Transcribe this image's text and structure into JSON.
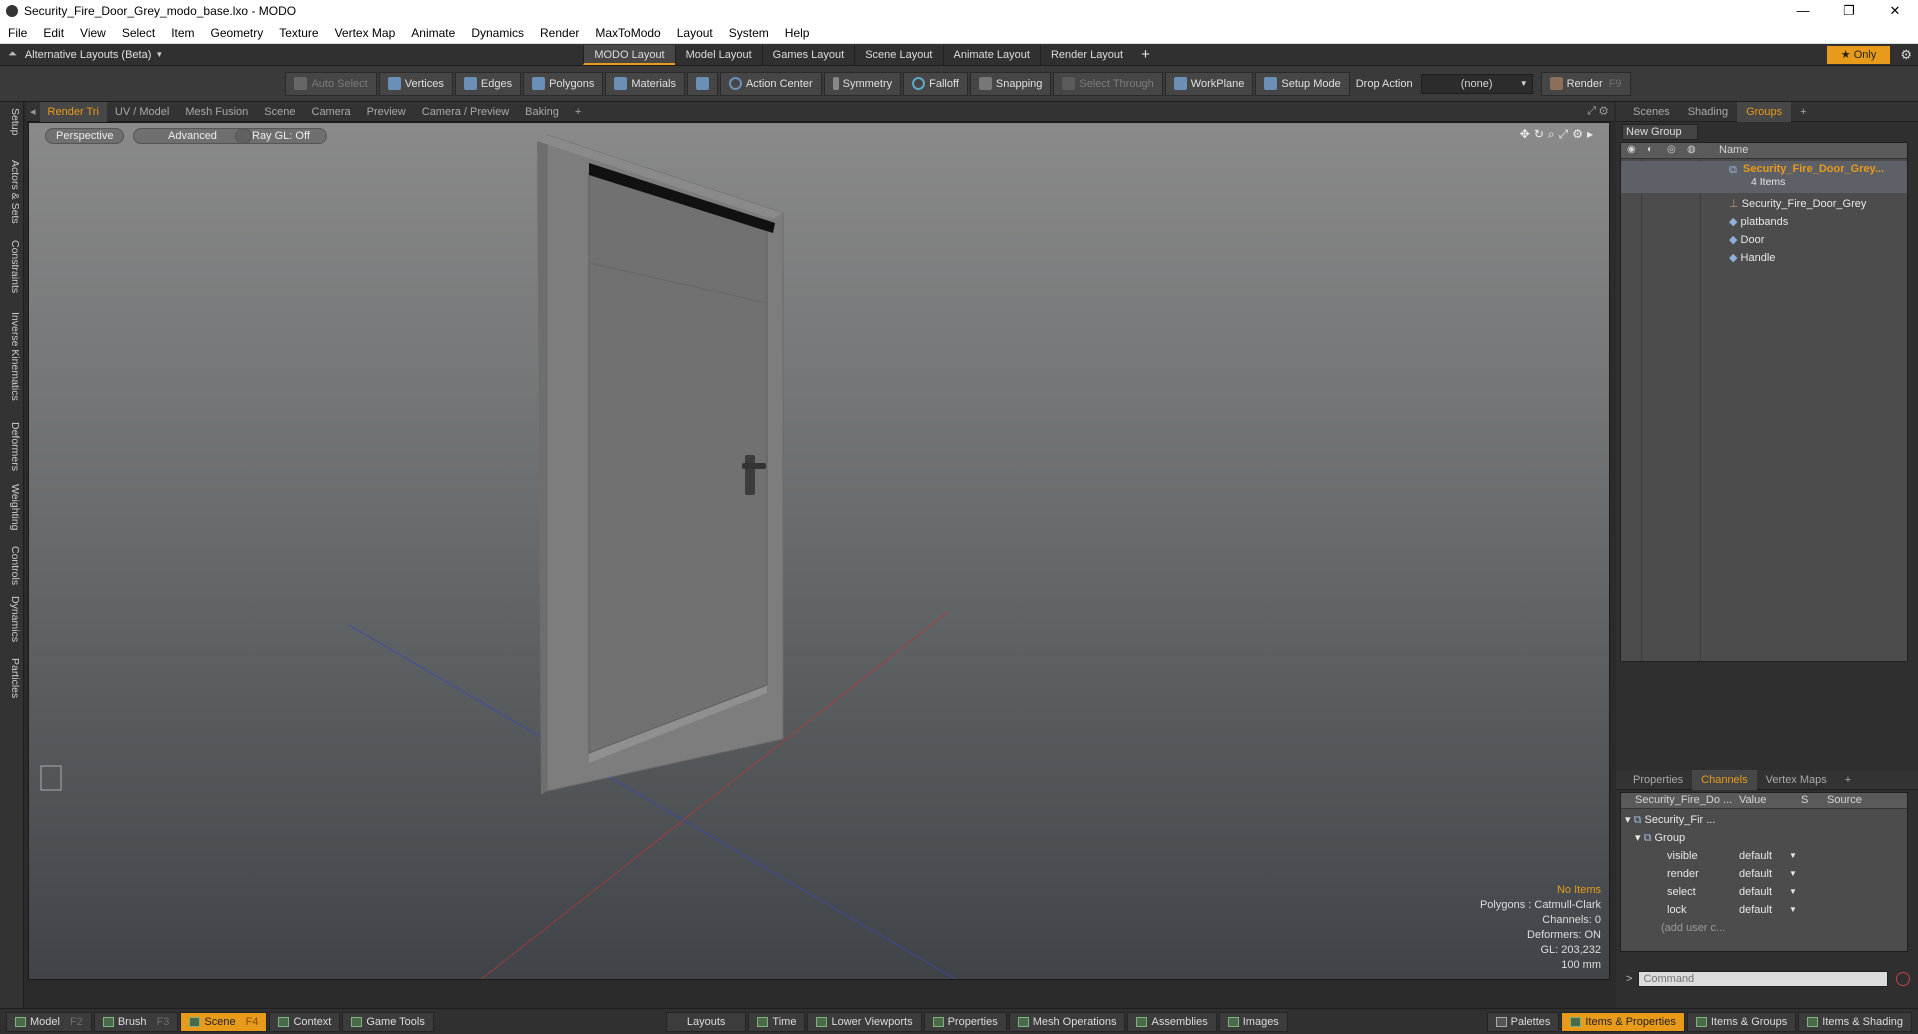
{
  "window": {
    "title": "Security_Fire_Door_Grey_modo_base.lxo - MODO",
    "min": "—",
    "max": "❐",
    "close": "✕"
  },
  "menu": [
    "File",
    "Edit",
    "View",
    "Select",
    "Item",
    "Geometry",
    "Texture",
    "Vertex Map",
    "Animate",
    "Dynamics",
    "Render",
    "MaxToModo",
    "Layout",
    "System",
    "Help"
  ],
  "layouts": {
    "alt": "Alternative Layouts (Beta)",
    "tabs": [
      "MODO Layout",
      "Model Layout",
      "Games Layout",
      "Scene Layout",
      "Animate Layout",
      "Render Layout"
    ],
    "only": "Only"
  },
  "toolbar": {
    "auto_select": "Auto Select",
    "vertices": "Vertices",
    "edges": "Edges",
    "polygons": "Polygons",
    "materials": "Materials",
    "action_center": "Action Center",
    "symmetry": "Symmetry",
    "falloff": "Falloff",
    "snapping": "Snapping",
    "select_through": "Select Through",
    "workplane": "WorkPlane",
    "setup_mode": "Setup Mode",
    "drop_action": "Drop Action",
    "drop_value": "(none)",
    "render": "Render",
    "render_key": "F9"
  },
  "left_tabs": [
    "Setup",
    "Actors & Sets",
    "Constraints",
    "Inverse Kinematics",
    "Deformers",
    "Weighting",
    "Controls",
    "Dynamics",
    "Particles"
  ],
  "viewport_tabs": [
    "Render Tri",
    "UV / Model",
    "Mesh Fusion",
    "Scene",
    "Camera",
    "Preview",
    "Camera / Preview",
    "Baking",
    "+"
  ],
  "viewport": {
    "perspective": "Perspective",
    "advanced": "Advanced",
    "raygl": "Ray GL: Off",
    "info": [
      "No Items",
      "Polygons : Catmull-Clark",
      "Channels: 0",
      "Deformers: ON",
      "GL: 203,232",
      "100 mm"
    ]
  },
  "top_panel": {
    "tabs": [
      "Scenes",
      "Shading",
      "Groups",
      "+"
    ],
    "new_group": "New Group",
    "name_header": "Name",
    "group_name": "Security_Fire_Door_Grey...",
    "group_count": "4 Items",
    "items": [
      "Security_Fire_Door_Grey",
      "platbands",
      "Door",
      "Handle"
    ]
  },
  "bottom_panel": {
    "tabs": [
      "Properties",
      "Channels",
      "Vertex Maps",
      "+"
    ],
    "headers": [
      "Security_Fire_Do ...",
      "Value",
      "S",
      "Source"
    ],
    "root": "Security_Fir ...",
    "group": "Group",
    "channels": [
      {
        "name": "visible",
        "value": "default"
      },
      {
        "name": "render",
        "value": "default"
      },
      {
        "name": "select",
        "value": "default"
      },
      {
        "name": "lock",
        "value": "default"
      }
    ],
    "add_user": "(add user c...",
    "command_placeholder": "Command"
  },
  "statusbar": {
    "left": [
      {
        "label": "Model",
        "key": "F2"
      },
      {
        "label": "Brush",
        "key": "F3"
      },
      {
        "label": "Scene",
        "key": "F4"
      },
      {
        "label": "Context",
        "key": ""
      },
      {
        "label": "Game Tools",
        "key": ""
      }
    ],
    "middle": [
      "Layouts",
      "Time",
      "Lower Viewports",
      "Properties",
      "Mesh Operations",
      "Assemblies",
      "Images"
    ],
    "right": [
      "Palettes",
      "Items & Properties",
      "Items & Groups",
      "Items & Shading"
    ]
  },
  "colors": {
    "accent": "#e89b1b"
  }
}
